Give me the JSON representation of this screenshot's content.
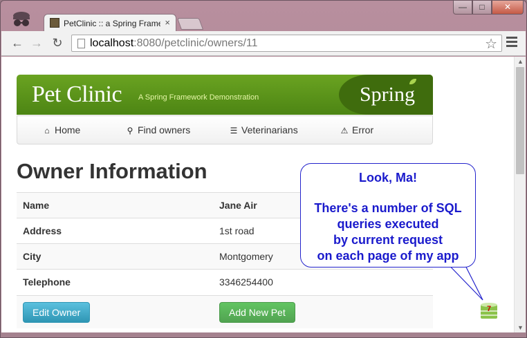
{
  "browser": {
    "tab_title": "PetClinic :: a Spring Frame",
    "tab_close": "×",
    "url_host": "localhost",
    "url_rest": ":8080/petclinic/owners/11"
  },
  "banner": {
    "brand": "Pet Clinic",
    "tagline": "A Spring Framework Demonstration",
    "logo_text": "Spring"
  },
  "nav": {
    "items": [
      {
        "label": "Home",
        "icon": "home-icon"
      },
      {
        "label": "Find owners",
        "icon": "search-icon"
      },
      {
        "label": "Veterinarians",
        "icon": "list-icon"
      },
      {
        "label": "Error",
        "icon": "warning-icon"
      }
    ]
  },
  "page": {
    "title": "Owner Information"
  },
  "owner": {
    "rows": [
      {
        "label": "Name",
        "value": "Jane Air"
      },
      {
        "label": "Address",
        "value": "1st road"
      },
      {
        "label": "City",
        "value": "Montgomery"
      },
      {
        "label": "Telephone",
        "value": "3346254400"
      }
    ],
    "edit_button": "Edit Owner",
    "add_pet_button": "Add New Pet"
  },
  "callout": {
    "line1": "Look, Ma!",
    "line2": "There's a number of SQL",
    "line3": "queries executed",
    "line4": "by current request",
    "line5": "on each page of my app"
  },
  "sql_counter": {
    "count": "7",
    "icon": "database-icon"
  },
  "colors": {
    "banner_green": "#5a9a1a",
    "callout_blue": "#1a1acc",
    "edit_button": "#2f96b4",
    "add_button": "#51a351"
  }
}
